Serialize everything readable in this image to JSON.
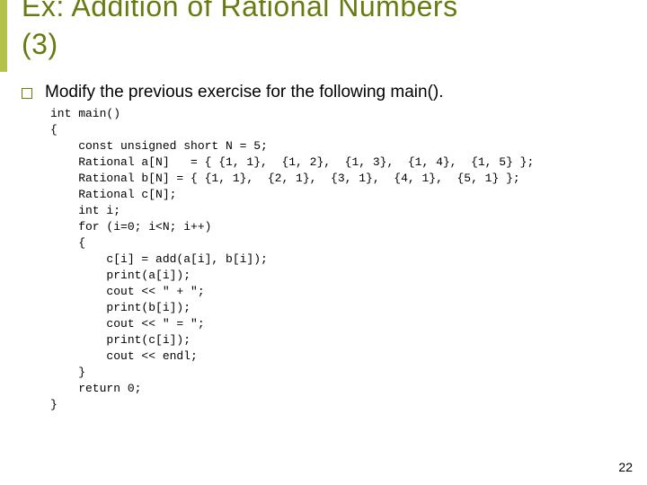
{
  "title_line1": "Ex: Addition of Rational Numbers",
  "title_line2": "(3)",
  "bullet_text": "Modify the previous exercise for the following main().",
  "code": "int main()\n{\n    const unsigned short N = 5;\n    Rational a[N]   = { {1, 1},  {1, 2},  {1, 3},  {1, 4},  {1, 5} };\n    Rational b[N] = { {1, 1},  {2, 1},  {3, 1},  {4, 1},  {5, 1} };\n    Rational c[N];\n    int i;\n    for (i=0; i<N; i++)\n    {\n        c[i] = add(a[i], b[i]);\n        print(a[i]);\n        cout << \" + \";\n        print(b[i]);\n        cout << \" = \";\n        print(c[i]);\n        cout << endl;\n    }\n    return 0;\n}",
  "page_number": "22"
}
